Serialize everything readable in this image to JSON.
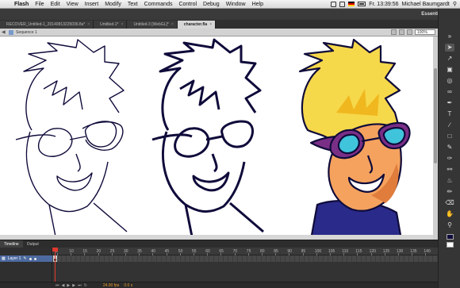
{
  "menubar": {
    "apple": "",
    "app_name": "Flash",
    "items": [
      "File",
      "Edit",
      "View",
      "Insert",
      "Modify",
      "Text",
      "Commands",
      "Control",
      "Debug",
      "Window",
      "Help"
    ],
    "clock": "Fr. 13:39:56",
    "user": "Michael Baumgardt"
  },
  "appbar": {
    "workspace": "Essentials"
  },
  "tabs": [
    {
      "label": "RECOVER_Untitled-1_20140813225036.fla*"
    },
    {
      "label": "Untitled-1*"
    },
    {
      "label": "Untitled-3 [WebGL]*"
    },
    {
      "label": "character.fla"
    }
  ],
  "editbar": {
    "scene": "Sequence 1",
    "zoom": "100%"
  },
  "timeline": {
    "tabs": [
      "Timeline",
      "Output"
    ],
    "layer_name": "Layer 1",
    "ruler": [
      "5",
      "10",
      "15",
      "20",
      "25",
      "30",
      "35",
      "40",
      "45",
      "50",
      "55",
      "60",
      "65",
      "70",
      "75",
      "80",
      "85",
      "90",
      "95",
      "100",
      "105",
      "110",
      "115",
      "120",
      "125",
      "130",
      "135",
      "140"
    ],
    "fps": "24.00 fps",
    "time": "0.0 s"
  },
  "colors": {
    "stroke": "#0f0b3a",
    "hair": "#f6d84b",
    "hair_shade": "#f0b81e",
    "skin": "#f5a25e",
    "skin_shade": "#e07c3c",
    "goggle": "#7a2f86",
    "lens": "#3fc4dc",
    "shirt": "#2a2a8a"
  }
}
